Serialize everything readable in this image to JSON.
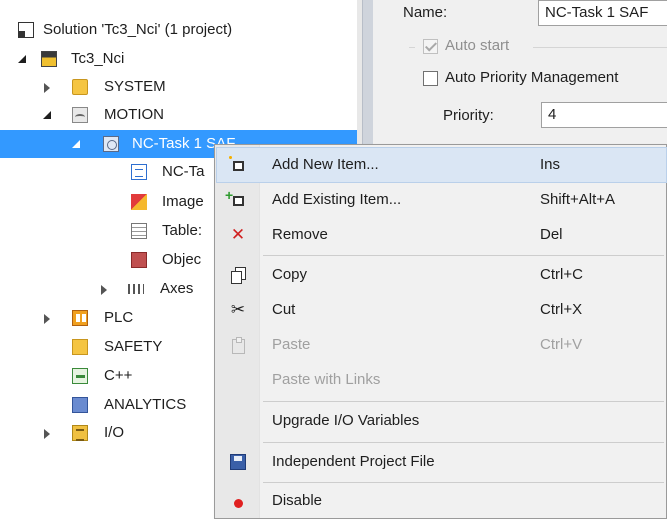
{
  "tree": {
    "solution": "Solution 'Tc3_Nci' (1 project)",
    "project": "Tc3_Nci",
    "system": "SYSTEM",
    "motion": "MOTION",
    "nc_task": "NC-Task 1 SAF",
    "nc_task_child": "NC-Ta",
    "image": "Image",
    "tables": "Table:",
    "objects": "Objec",
    "axes": "Axes",
    "plc": "PLC",
    "safety": "SAFETY",
    "cpp": "C++",
    "analytics": "ANALYTICS",
    "io": "I/O"
  },
  "properties": {
    "name_label": "Name:",
    "name_value": "NC-Task 1 SAF",
    "auto_start_label": "Auto start",
    "auto_start_checked": true,
    "auto_priority_label": "Auto Priority Management",
    "auto_priority_checked": false,
    "priority_label": "Priority:",
    "priority_value": "4"
  },
  "context_menu": {
    "items": [
      {
        "label": "Add New Item...",
        "shortcut": "Ins",
        "icon": "add-new-item-icon"
      },
      {
        "label": "Add Existing Item...",
        "shortcut": "Shift+Alt+A",
        "icon": "add-existing-item-icon"
      },
      {
        "label": "Remove",
        "shortcut": "Del",
        "icon": "remove-icon"
      },
      {
        "label": "Copy",
        "shortcut": "Ctrl+C",
        "icon": "copy-icon"
      },
      {
        "label": "Cut",
        "shortcut": "Ctrl+X",
        "icon": "cut-icon"
      },
      {
        "label": "Paste",
        "shortcut": "Ctrl+V",
        "icon": "paste-icon",
        "disabled": true
      },
      {
        "label": "Paste with Links",
        "shortcut": "",
        "disabled": true
      },
      {
        "label": "Upgrade I/O Variables",
        "shortcut": ""
      },
      {
        "label": "Independent Project File",
        "shortcut": "",
        "icon": "save-icon"
      },
      {
        "label": "Disable",
        "shortcut": "",
        "icon": "disable-icon"
      }
    ]
  },
  "colors": {
    "selection": "#3399ff",
    "menu_hover": "#dae6f4",
    "remove_icon": "#d02020",
    "disable_icon": "#e02020"
  }
}
